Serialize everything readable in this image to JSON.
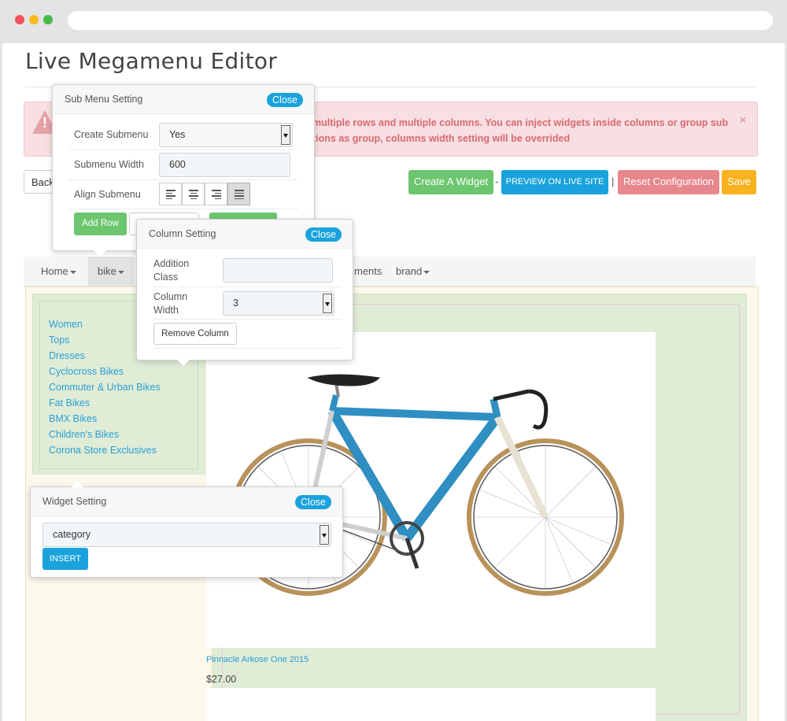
{
  "page": {
    "title": "Live Megamenu Editor"
  },
  "colors": {
    "red": "#f5505b",
    "yellow": "#f7bb1f",
    "green": "#47bb4a",
    "success": "#6cc66f",
    "info": "#19a2dc",
    "danger": "#e6878c",
    "warning": "#f8b21d"
  },
  "alert": {
    "icon": "warning-icon",
    "text": "multiple rows and multiple columns. You can inject widgets inside columns or group sub tions as group, columns width setting will be overrided",
    "close": "×"
  },
  "toolbar": {
    "back_label": "Back",
    "create_widget": "Create A Widget",
    "dash": "-",
    "preview": "PREVIEW ON LIVE SITE",
    "pipe": "|",
    "reset": "Reset Configuration",
    "save": "Save"
  },
  "nav": {
    "items": [
      {
        "label": "Home"
      },
      {
        "label": "bike"
      },
      {
        "label": "ments"
      },
      {
        "label": "brand"
      }
    ]
  },
  "categories": [
    "Women",
    "Tops",
    "Dresses",
    "Cyclocross Bikes",
    "Commuter & Urban Bikes",
    "Fat Bikes",
    "BMX Bikes",
    "Children's Bikes",
    "Corona Store Exclusives"
  ],
  "product": {
    "name": "Pinnacle Arkose One 2015",
    "price": "$27.00"
  },
  "submenu_setting": {
    "title": "Sub Menu Setting",
    "close": "Close",
    "create_label": "Create Submenu",
    "create_value": "Yes",
    "width_label": "Submenu Width",
    "width_value": "600",
    "align_label": "Align Submenu",
    "add_row": "Add Row"
  },
  "column_setting": {
    "title": "Column Setting",
    "close": "Close",
    "class_label_1": "Addition",
    "class_label_2": "Class",
    "width_label_1": "Column",
    "width_label_2": "Width",
    "width_value": "3",
    "remove": "Remove Column"
  },
  "widget_setting": {
    "title": "Widget Setting",
    "close": "Close",
    "select_value": "category",
    "insert": "INSERT"
  }
}
